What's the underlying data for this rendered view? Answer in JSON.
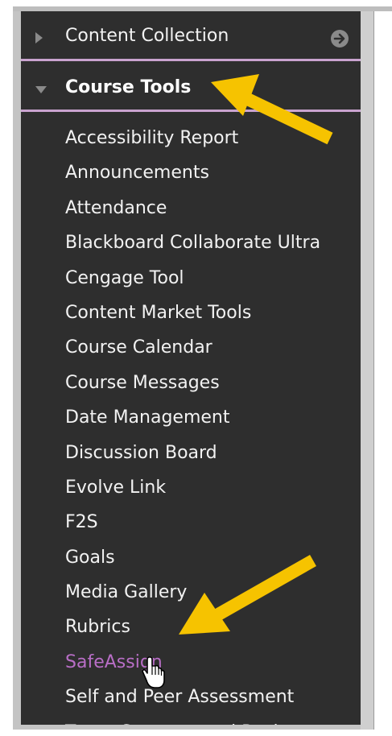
{
  "panel": {
    "sections": [
      {
        "label": "Content Collection",
        "expanded": false,
        "bold": false
      },
      {
        "label": "Course Tools",
        "expanded": true,
        "bold": true
      }
    ],
    "course_tools": [
      "Accessibility Report",
      "Announcements",
      "Attendance",
      "Blackboard Collaborate Ultra",
      "Cengage Tool",
      "Content Market Tools",
      "Course Calendar",
      "Course Messages",
      "Date Management",
      "Discussion Board",
      "Evolve Link",
      "F2S",
      "Goals",
      "Media Gallery",
      "Rubrics",
      "SafeAssign",
      "Self and Peer Assessment",
      "Tests, Surveys, and Pools"
    ],
    "active_item": "SafeAssign"
  },
  "icons": {
    "collapsed": "triangle-right-icon",
    "expanded": "triangle-down-icon",
    "go": "arrow-circle-right-icon",
    "annotation": "yellow-arrow-icon",
    "cursor": "hand-pointer-icon"
  },
  "colors": {
    "panel_bg": "#2e2e2e",
    "text": "#f2f2f2",
    "active": "#b86ec6",
    "divider": "#c9a3cf",
    "annotation_arrow": "#f6c300"
  }
}
